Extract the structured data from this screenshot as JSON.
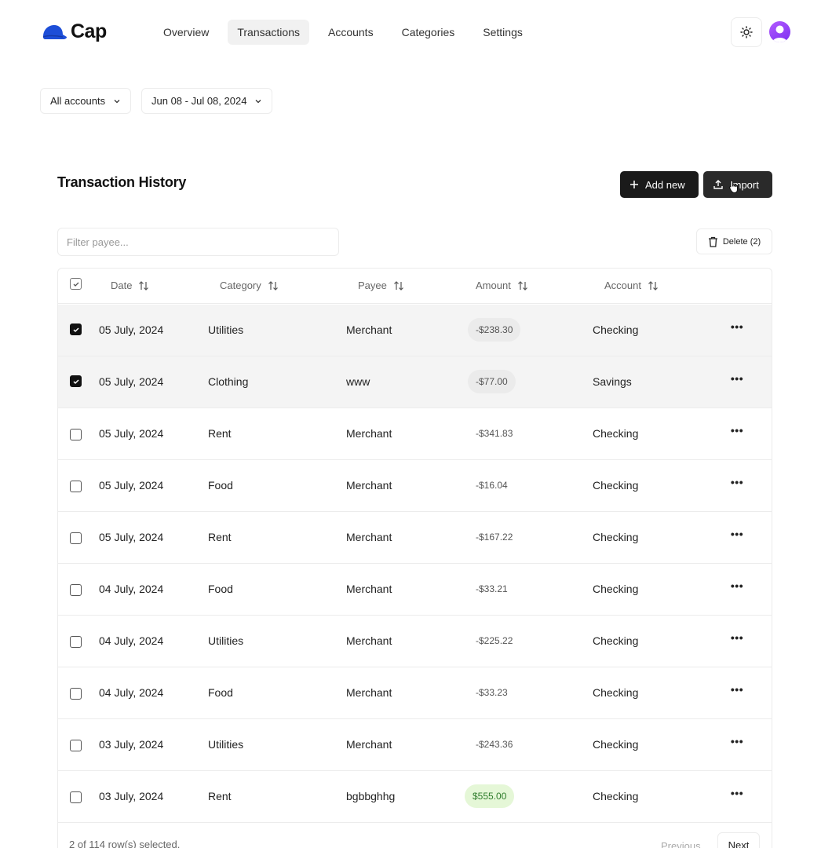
{
  "app": {
    "name": "Cap"
  },
  "nav": [
    {
      "label": "Overview",
      "active": false
    },
    {
      "label": "Transactions",
      "active": true
    },
    {
      "label": "Accounts",
      "active": false
    },
    {
      "label": "Categories",
      "active": false
    },
    {
      "label": "Settings",
      "active": false
    }
  ],
  "header": {
    "theme_icon": "sun-icon",
    "avatar_icon": "user-avatar"
  },
  "filters": {
    "account": "All accounts",
    "date_range": "Jun 08 - Jul 08, 2024"
  },
  "card": {
    "title": "Transaction History",
    "add_label": "Add new",
    "import_label": "Import",
    "filter_placeholder": "Filter payee...",
    "delete_label": "Delete (2)"
  },
  "columns": {
    "date": "Date",
    "category": "Category",
    "payee": "Payee",
    "amount": "Amount",
    "account": "Account"
  },
  "rows": [
    {
      "date": "05 July, 2024",
      "category": "Utilities",
      "payee": "Merchant",
      "amount": "-$238.30",
      "account": "Checking",
      "selected": true
    },
    {
      "date": "05 July, 2024",
      "category": "Clothing",
      "payee": "www",
      "amount": "-$77.00",
      "account": "Savings",
      "selected": true
    },
    {
      "date": "05 July, 2024",
      "category": "Rent",
      "payee": "Merchant",
      "amount": "-$341.83",
      "account": "Checking",
      "selected": false
    },
    {
      "date": "05 July, 2024",
      "category": "Food",
      "payee": "Merchant",
      "amount": "-$16.04",
      "account": "Checking",
      "selected": false
    },
    {
      "date": "05 July, 2024",
      "category": "Rent",
      "payee": "Merchant",
      "amount": "-$167.22",
      "account": "Checking",
      "selected": false
    },
    {
      "date": "04 July, 2024",
      "category": "Food",
      "payee": "Merchant",
      "amount": "-$33.21",
      "account": "Checking",
      "selected": false
    },
    {
      "date": "04 July, 2024",
      "category": "Utilities",
      "payee": "Merchant",
      "amount": "-$225.22",
      "account": "Checking",
      "selected": false
    },
    {
      "date": "04 July, 2024",
      "category": "Food",
      "payee": "Merchant",
      "amount": "-$33.23",
      "account": "Checking",
      "selected": false
    },
    {
      "date": "03 July, 2024",
      "category": "Utilities",
      "payee": "Merchant",
      "amount": "-$243.36",
      "account": "Checking",
      "selected": false
    },
    {
      "date": "03 July, 2024",
      "category": "Rent",
      "payee": "bgbbghhg",
      "amount": "$555.00",
      "account": "Checking",
      "selected": false
    }
  ],
  "footer": {
    "selection": "2 of 114 row(s) selected.",
    "previous": "Previous",
    "next": "Next"
  },
  "colors": {
    "accent_dark": "#1a1a1a",
    "positive_bg": "#e5f7d7",
    "positive_text": "#2f7d2c",
    "avatar": "#9b3ff5",
    "logo": "#1d4ed8"
  }
}
